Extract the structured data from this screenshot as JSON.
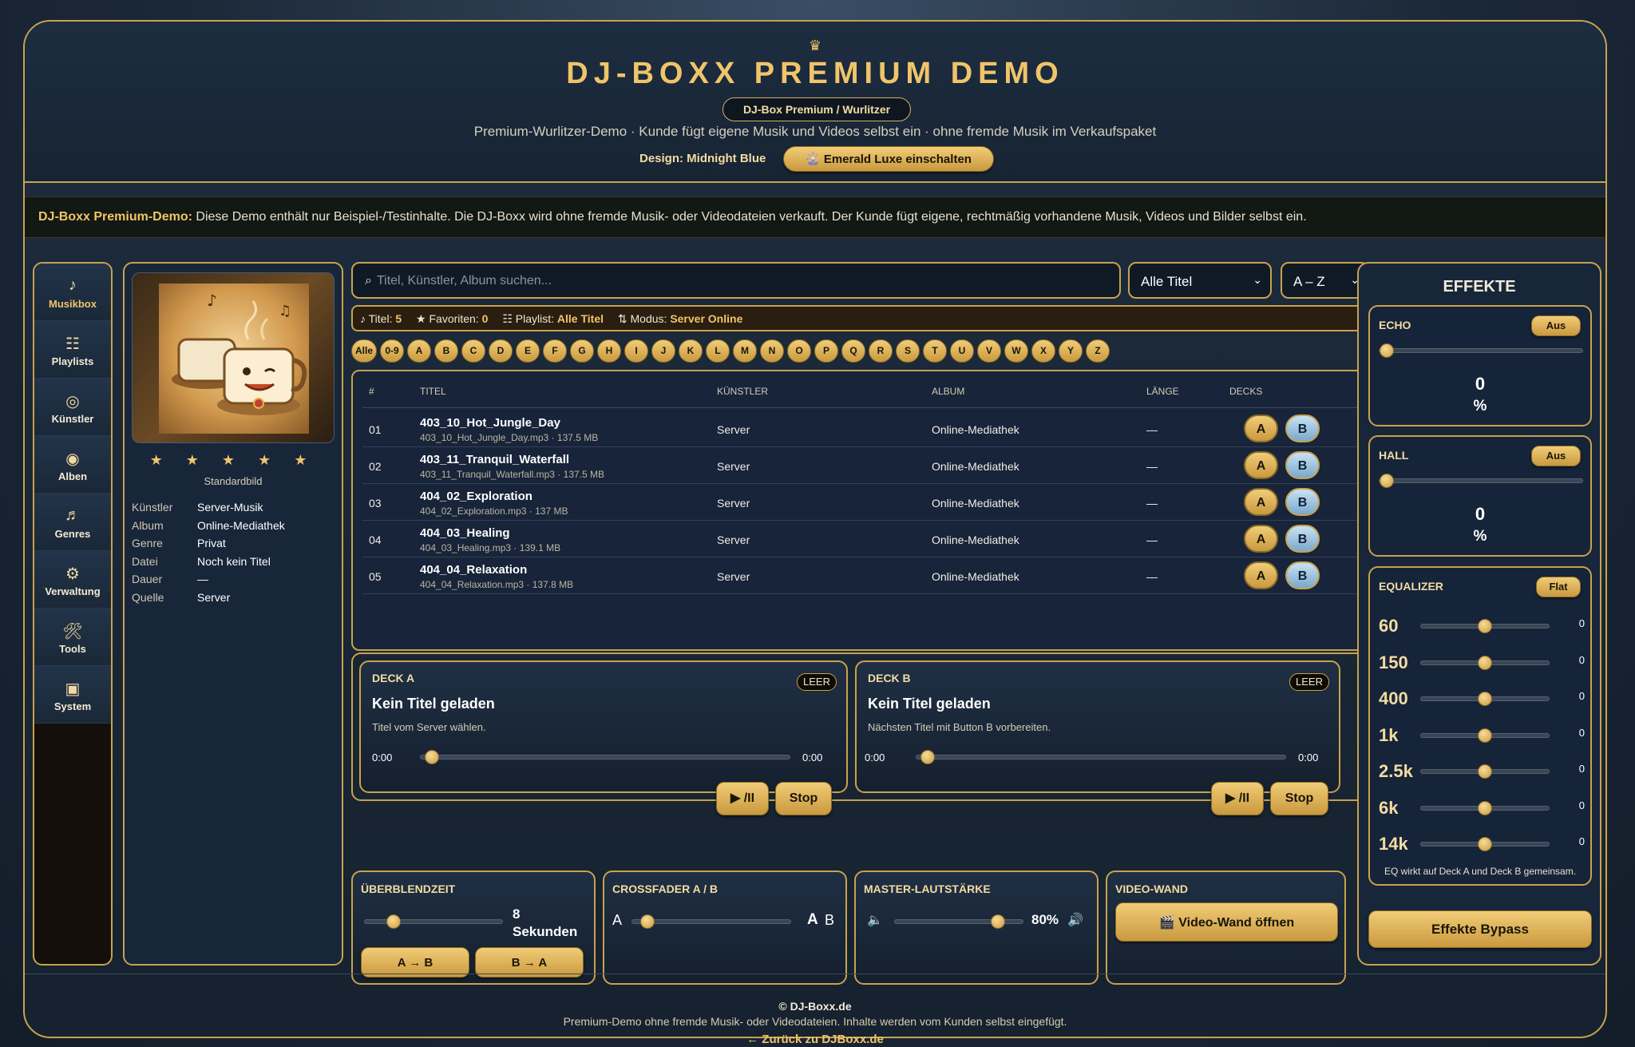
{
  "header": {
    "crown_icon": "crown-icon",
    "title": "DJ-BOXX PREMIUM DEMO",
    "pill": "DJ-Box Premium / Wurlitzer",
    "subtitle": "Premium-Wurlitzer-Demo · Kunde fügt eigene Musik und Videos selbst ein · ohne fremde Musik im Verkaufspaket",
    "design_label": "Design: Midnight Blue",
    "theme_button": "🎡 Emerald Luxe einschalten"
  },
  "notice": {
    "lead": "DJ-Boxx Premium-Demo:",
    "text": " Diese Demo enthält nur Beispiel-/Testinhalte. Die DJ-Boxx wird ohne fremde Musik- oder Videodateien verkauft. Der Kunde fügt eigene, rechtmäßig vorhandene Musik, Videos und Bilder selbst ein."
  },
  "sidebar": {
    "items": [
      {
        "icon": "♪",
        "label": "Musikbox"
      },
      {
        "icon": "☷",
        "label": "Playlists"
      },
      {
        "icon": "◎",
        "label": "Künstler"
      },
      {
        "icon": "◉",
        "label": "Alben"
      },
      {
        "icon": "♬",
        "label": "Genres"
      },
      {
        "icon": "⚙",
        "label": "Verwaltung"
      },
      {
        "icon": "🛠",
        "label": "Tools"
      },
      {
        "icon": "▣",
        "label": "System"
      }
    ]
  },
  "info": {
    "stars": "★ ★ ★ ★ ★",
    "cover_caption": "Standardbild",
    "meta": [
      {
        "k": "Künstler",
        "v": "Server-Musik"
      },
      {
        "k": "Album",
        "v": "Online-Mediathek"
      },
      {
        "k": "Genre",
        "v": "Privat"
      },
      {
        "k": "Datei",
        "v": "Noch kein Titel"
      },
      {
        "k": "Dauer",
        "v": "—"
      },
      {
        "k": "Quelle",
        "v": "Server"
      }
    ]
  },
  "search": {
    "icon": "⌕",
    "placeholder": "Titel, Künstler, Album suchen..."
  },
  "filter": {
    "selected": "Alle Titel"
  },
  "sort": {
    "selected": "A – Z"
  },
  "status": {
    "titles_label": "♪ Titel:",
    "titles_value": "5",
    "fav_label": "★ Favoriten:",
    "fav_value": "0",
    "playlist_label": "☷ Playlist:",
    "playlist_value": "Alle Titel",
    "mode_label": "⇅ Modus:",
    "mode_value": "Server Online"
  },
  "letters": [
    "Alle",
    "0-9",
    "A",
    "B",
    "C",
    "D",
    "E",
    "F",
    "G",
    "H",
    "I",
    "J",
    "K",
    "L",
    "M",
    "N",
    "O",
    "P",
    "Q",
    "R",
    "S",
    "T",
    "U",
    "V",
    "W",
    "X",
    "Y",
    "Z"
  ],
  "table": {
    "headers": {
      "num": "#",
      "title": "TITEL",
      "artist": "KÜNSTLER",
      "album": "ALBUM",
      "length": "LÄNGE",
      "decks": "DECKS"
    },
    "rows": [
      {
        "num": "01",
        "title": "403_10_Hot_Jungle_Day",
        "file": "403_10_Hot_Jungle_Day.mp3 · 137.5 MB",
        "artist": "Server",
        "album": "Online-Mediathek",
        "length": "—",
        "a": "A",
        "b": "B"
      },
      {
        "num": "02",
        "title": "403_11_Tranquil_Waterfall",
        "file": "403_11_Tranquil_Waterfall.mp3 · 137.5 MB",
        "artist": "Server",
        "album": "Online-Mediathek",
        "length": "—",
        "a": "A",
        "b": "B"
      },
      {
        "num": "03",
        "title": "404_02_Exploration",
        "file": "404_02_Exploration.mp3 · 137 MB",
        "artist": "Server",
        "album": "Online-Mediathek",
        "length": "—",
        "a": "A",
        "b": "B"
      },
      {
        "num": "04",
        "title": "404_03_Healing",
        "file": "404_03_Healing.mp3 · 139.1 MB",
        "artist": "Server",
        "album": "Online-Mediathek",
        "length": "—",
        "a": "A",
        "b": "B"
      },
      {
        "num": "05",
        "title": "404_04_Relaxation",
        "file": "404_04_Relaxation.mp3 · 137.8 MB",
        "artist": "Server",
        "album": "Online-Mediathek",
        "length": "—",
        "a": "A",
        "b": "B"
      }
    ]
  },
  "decks": {
    "a": {
      "title": "DECK A",
      "badge": "LEER",
      "track": "Kein Titel geladen",
      "hint": "Titel vom Server wählen.",
      "time_start": "0:00",
      "time_end": "0:00",
      "play": "▶ /II",
      "stop": "Stop"
    },
    "b": {
      "title": "DECK B",
      "badge": "LEER",
      "track": "Kein Titel geladen",
      "hint": "Nächsten Titel mit Button B vorbereiten.",
      "time_start": "0:00",
      "time_end": "0:00",
      "play": "▶ /II",
      "stop": "Stop"
    }
  },
  "crossfade_time": {
    "title": "ÜBERBLENDZEIT",
    "value_line1": "8",
    "value_line2": "Sekunden",
    "btn_ab": "A → B",
    "btn_ba": "B → A"
  },
  "crossfader": {
    "title": "CROSSFADER A / B",
    "left": "A",
    "right_a": "A",
    "right_b": "B"
  },
  "master": {
    "title": "MASTER-LAUTSTÄRKE",
    "value": "80%",
    "level": 0.8,
    "icon_low": "speaker-low-icon",
    "icon_high": "speaker-high-icon"
  },
  "videowall": {
    "title": "VIDEO-WAND",
    "button": "🎬 Video-Wand öffnen"
  },
  "effects": {
    "title": "EFFEKTE",
    "echo": {
      "label": "ECHO",
      "button": "Aus",
      "value": "0",
      "unit": "%"
    },
    "hall": {
      "label": "HALL",
      "button": "Aus",
      "value": "0",
      "unit": "%"
    },
    "eq": {
      "label": "EQUALIZER",
      "button": "Flat",
      "bands": [
        {
          "f": "60",
          "v": "0"
        },
        {
          "f": "150",
          "v": "0"
        },
        {
          "f": "400",
          "v": "0"
        },
        {
          "f": "1k",
          "v": "0"
        },
        {
          "f": "2.5k",
          "v": "0"
        },
        {
          "f": "6k",
          "v": "0"
        },
        {
          "f": "14k",
          "v": "0"
        }
      ],
      "note": "EQ wirkt auf Deck A und Deck B gemeinsam."
    },
    "bypass": "Effekte Bypass"
  },
  "footer": {
    "copyright": "© DJ-Boxx.de",
    "text": "Premium-Demo ohne fremde Musik- oder Videodateien. Inhalte werden vom Kunden selbst eingefügt.",
    "back_link": "← Zurück zu DJBoxx.de"
  },
  "colors": {
    "accent_gold": "#c9a24d",
    "bg_navy": "#1b2838",
    "deck_b_blue": "#7aa8cc"
  }
}
